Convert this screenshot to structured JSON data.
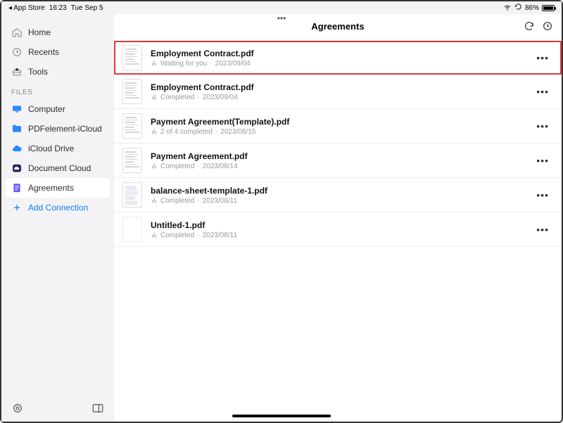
{
  "statusbar": {
    "back_app": "◂ App Store",
    "time": "16:23",
    "date": "Tue Sep 5",
    "battery": "86%"
  },
  "sidebar": {
    "main": [
      {
        "label": "Home",
        "icon": "home"
      },
      {
        "label": "Recents",
        "icon": "clock"
      },
      {
        "label": "Tools",
        "icon": "toolbox"
      }
    ],
    "files_section": "FILES",
    "files": [
      {
        "label": "Computer",
        "icon": "computer",
        "color": "#2b88ff"
      },
      {
        "label": "PDFelement-iCloud",
        "icon": "folder",
        "color": "#2b88ff"
      },
      {
        "label": "iCloud Drive",
        "icon": "icloud",
        "color": "#2b88ff"
      },
      {
        "label": "Document Cloud",
        "icon": "cloud",
        "color": "#1f2a5e"
      },
      {
        "label": "Agreements",
        "icon": "agreement",
        "color": "#5b5bff",
        "selected": true
      }
    ],
    "add_connection": "Add Connection"
  },
  "header": {
    "title": "Agreements"
  },
  "files": [
    {
      "name": "Employment Contract.pdf",
      "status": "Waiting for you",
      "date": "2023/09/04",
      "highlighted": true,
      "thumb": "doc"
    },
    {
      "name": "Employment Contract.pdf",
      "status": "Completed",
      "date": "2023/09/04",
      "thumb": "doc"
    },
    {
      "name": "Payment Agreement(Template).pdf",
      "status": "2 of 4 completed",
      "date": "2023/08/15",
      "thumb": "doc"
    },
    {
      "name": "Payment Agreement.pdf",
      "status": "Completed",
      "date": "2023/08/14",
      "thumb": "doc"
    },
    {
      "name": "balance-sheet-template-1.pdf",
      "status": "Completed",
      "date": "2023/08/11",
      "thumb": "grid"
    },
    {
      "name": "Untitled-1.pdf",
      "status": "Completed",
      "date": "2023/08/11",
      "thumb": "blank"
    }
  ],
  "meta_sep": " · "
}
